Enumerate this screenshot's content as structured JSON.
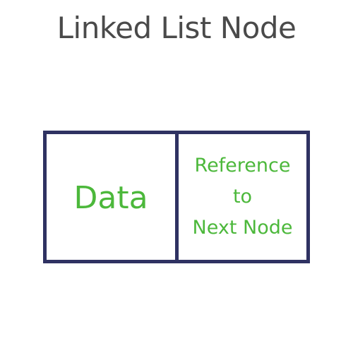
{
  "title": "Linked List Node",
  "node": {
    "data_label": "Data",
    "reference_lines": [
      "Reference",
      "to",
      "Next Node"
    ]
  },
  "colors": {
    "border": "#2f3262",
    "label": "#4cb83b",
    "title": "#4a4a4a",
    "background": "#ffffff"
  }
}
